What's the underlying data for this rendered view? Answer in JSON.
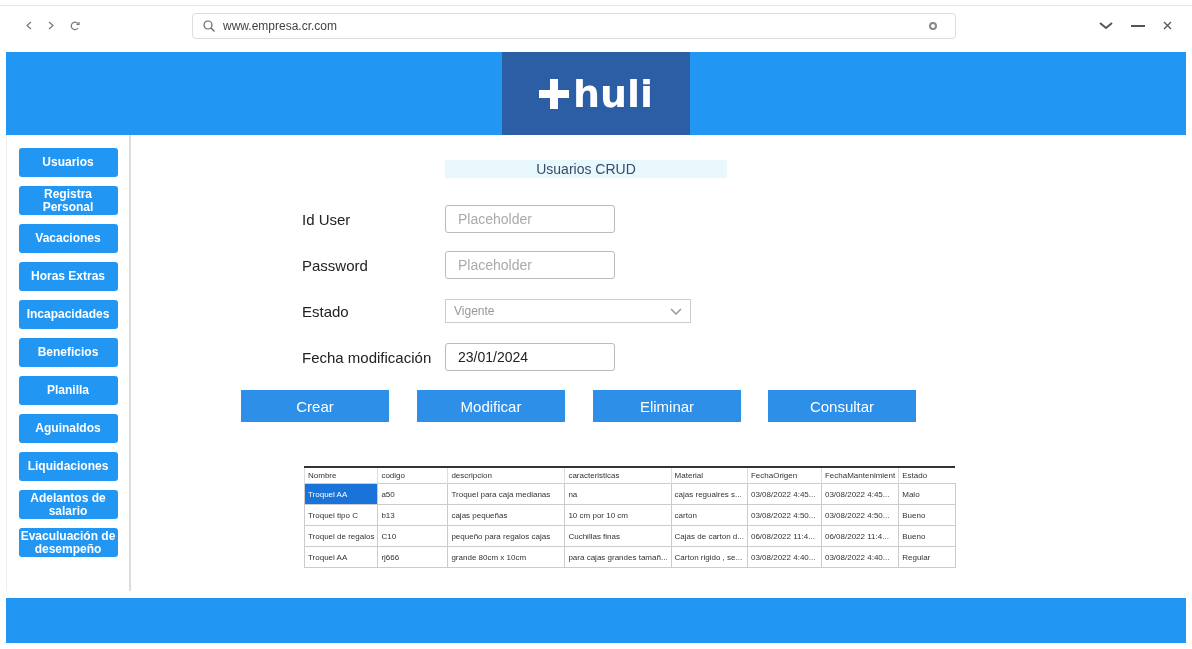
{
  "browser": {
    "url": "www.empresa.cr.com"
  },
  "logo": {
    "text": "huli"
  },
  "sidebar": {
    "items": [
      {
        "label": "Usuarios"
      },
      {
        "label": "Registra Personal"
      },
      {
        "label": "Vacaciones"
      },
      {
        "label": "Horas Extras"
      },
      {
        "label": "Incapacidades"
      },
      {
        "label": "Beneficios"
      },
      {
        "label": "Planilla"
      },
      {
        "label": "Aguinaldos"
      },
      {
        "label": "Liquidaciones"
      },
      {
        "label": "Adelantos de salario"
      },
      {
        "label": "Evaculuación de desempeño"
      }
    ]
  },
  "form": {
    "title": "Usuarios CRUD",
    "fields": [
      {
        "kind": "text",
        "label": "Id User",
        "placeholder": "Placeholder"
      },
      {
        "kind": "text",
        "label": "Password",
        "placeholder": "Placeholder"
      },
      {
        "kind": "select",
        "label": "Estado",
        "value": "Vigente"
      },
      {
        "kind": "text",
        "label": "Fecha modificación",
        "value": "23/01/2024"
      }
    ]
  },
  "buttons": [
    "Crear",
    "Modificar",
    "Eliminar",
    "Consultar"
  ],
  "table": {
    "columns": [
      "Nombre",
      "codigo",
      "descripcion",
      "caracteristicas",
      "Material",
      "FechaOrigen",
      "FechaMantenimient",
      "Estado"
    ],
    "rows": [
      {
        "selected": true,
        "cells": [
          "Troquel AA",
          "a50",
          "Troquel para caja medianas",
          "na",
          "cajas regualres s...",
          "03/08/2022 4:45...",
          "03/08/2022 4:45...",
          "Malo"
        ]
      },
      {
        "selected": false,
        "cells": [
          "Troquel tipo C",
          "b13",
          "cajas pequeñas",
          "10 cm por 10 cm",
          "carton",
          "03/08/2022 4:50...",
          "03/08/2022 4:50...",
          "Bueno"
        ]
      },
      {
        "selected": false,
        "cells": [
          "Troquel de regalos",
          "C10",
          "pequeño para regalos cajas",
          "Cuchillas finas",
          "Cajas de carton d...",
          "06/08/2022 11:4...",
          "06/08/2022 11:4...",
          "Bueno"
        ]
      },
      {
        "selected": false,
        "cells": [
          "Troquel AA",
          "rj666",
          "grande 80cm x 10cm",
          "para cajas grandes tamañ...",
          "Carton rigido , se...",
          "03/08/2022 4:40...",
          "03/08/2022 4:40...",
          "Regular"
        ]
      }
    ]
  }
}
